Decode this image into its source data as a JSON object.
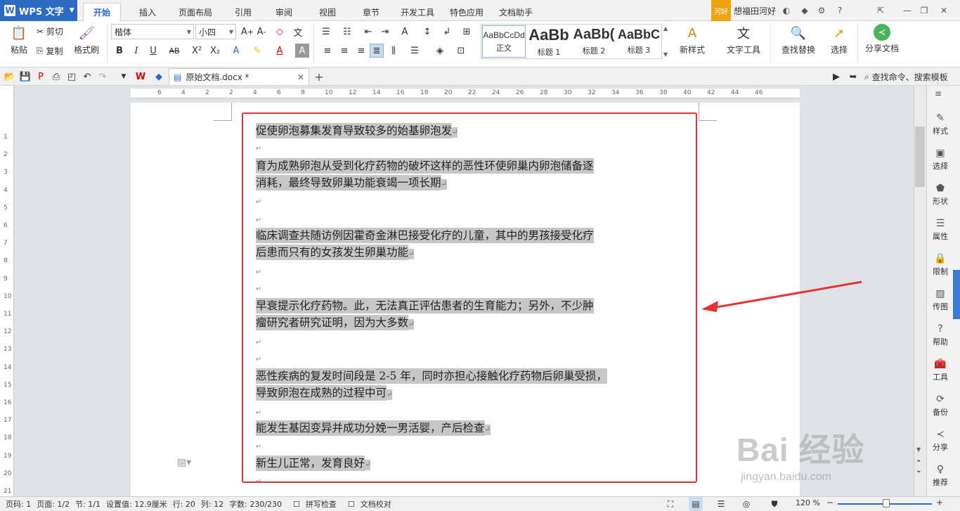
{
  "app": {
    "name": "WPS 文字",
    "logo": "W"
  },
  "menu_tabs": [
    "开始",
    "插入",
    "页面布局",
    "引用",
    "审阅",
    "视图",
    "章节",
    "开发工具",
    "特色应用",
    "文档助手"
  ],
  "user": {
    "tag": "河好",
    "name": "想福田河好"
  },
  "clipboard": {
    "paste": "粘贴",
    "cut": "剪切",
    "copy": "复制",
    "format_painter": "格式刷"
  },
  "font": {
    "name": "楷体",
    "size": "小四"
  },
  "styles": [
    {
      "preview": "AaBbCcDd",
      "label": "正文"
    },
    {
      "preview": "AaBb",
      "label": "标题 1"
    },
    {
      "preview": "AaBb(",
      "label": "标题 2"
    },
    {
      "preview": "AaBbC",
      "label": "标题 3"
    }
  ],
  "ribbon_right": {
    "new_style": "新样式",
    "text_tools": "文字工具",
    "find_replace": "查找替换",
    "select": "选择",
    "share": "分享文档"
  },
  "document": {
    "tab_name": "原始文档.docx *"
  },
  "search": {
    "label": "查找命令、搜索模板"
  },
  "paragraphs": [
    [
      "促使卵泡募集发育导致较多的始基卵泡发"
    ],
    [
      "育为成熟卵泡从受到化疗药物的破坏这样的恶性环使卵巢内卵泡储备逐",
      "消耗，最终导致卵巢功能衰竭一项长期"
    ],
    [
      "临床调查共随访例因霍奇金淋巴接受化疗的儿童，其中的男孩接受化疗",
      "后患而只有的女孩发生卵巢功能"
    ],
    [
      "早衰提示化疗药物。此，无法真正评估患者的生育能力；另外，不少肿",
      "瘤研究者研究证明，因为大多数"
    ],
    [
      "恶性疾病的复发时间段是 2-5 年，同时亦担心接触化疗药物后卵巢受损，",
      "导致卵泡在成熟的过程中可"
    ],
    [
      "能发生基因变异并成功分娩一男活婴，产后检查"
    ],
    [
      "新生儿正常，发育良好"
    ]
  ],
  "right_panel": [
    "样式",
    "选择",
    "形状",
    "属性",
    "限制",
    "传图",
    "帮助",
    "工具",
    "备份",
    "分享",
    "推荐"
  ],
  "ruler": {
    "h_ticks": [
      "6",
      "4",
      "2",
      "2",
      "4",
      "6",
      "8",
      "10",
      "12",
      "14",
      "16",
      "18",
      "20",
      "22",
      "24",
      "26",
      "28",
      "30",
      "32",
      "34",
      "36",
      "38",
      "40",
      "42",
      "44",
      "46"
    ],
    "v_ticks": [
      "1",
      "2",
      "3",
      "4",
      "5",
      "6",
      "7",
      "8",
      "9",
      "10",
      "11",
      "12",
      "13",
      "14",
      "15",
      "16",
      "17",
      "18",
      "19",
      "20",
      "21"
    ]
  },
  "status": {
    "page_num": "页码: 1",
    "page": "页面: 1/2",
    "section": "节: 1/1",
    "setting": "设置值: 12.9厘米",
    "row": "行: 20",
    "col": "列: 12",
    "words": "字数: 230/230",
    "spell": "拼写检查",
    "proof": "文档校对",
    "zoom": "120 %"
  },
  "watermark": {
    "text": "Bai 经验",
    "url": "jingyan.baidu.com"
  },
  "colors": {
    "accent": "#2b6bc4",
    "highlight": "#c7c7c7",
    "annotation": "#e53333"
  }
}
